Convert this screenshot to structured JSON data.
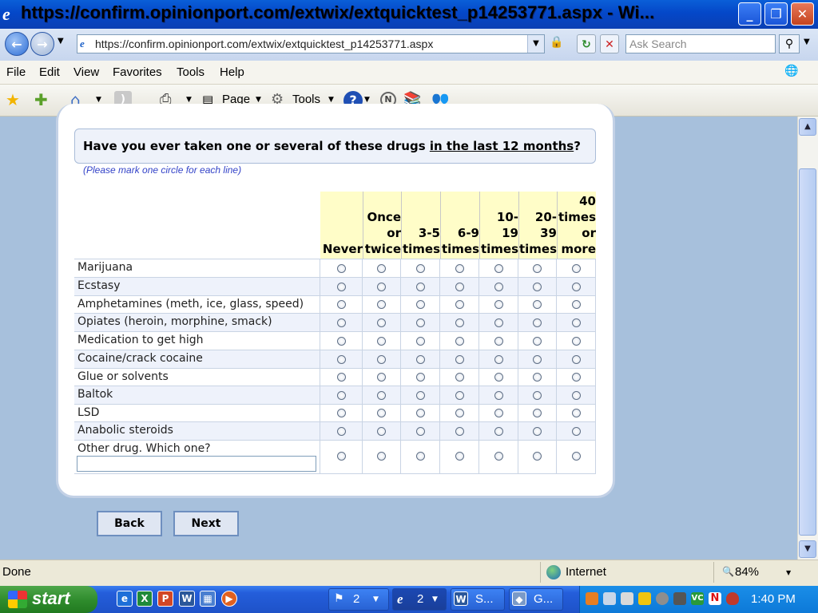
{
  "window": {
    "title": "https://confirm.opinionport.com/extwix/extquicktest_p14253771.aspx - Wi...",
    "minimize": "_",
    "maximize": "❐",
    "close": "✕"
  },
  "address": {
    "url": "https://confirm.opinionport.com/extwix/extquicktest_p14253771.aspx",
    "search_placeholder": "Ask Search"
  },
  "menu": [
    "File",
    "Edit",
    "View",
    "Favorites",
    "Tools",
    "Help"
  ],
  "command_bar": {
    "page": "Page",
    "tools": "Tools"
  },
  "survey": {
    "question_prefix": "Have you ever taken one or several of these drugs ",
    "question_emph": "in the last 12 months",
    "question_suffix": "?",
    "instruction": "(Please mark one circle for each line)",
    "columns": [
      [
        "Never"
      ],
      [
        "Once",
        "or",
        "twice"
      ],
      [
        "3-5",
        "times"
      ],
      [
        "6-9",
        "times"
      ],
      [
        "10-",
        "19",
        "times"
      ],
      [
        "20-",
        "39",
        "times"
      ],
      [
        "40",
        "times",
        "or",
        "more"
      ]
    ],
    "rows": [
      "Marijuana",
      "Ecstasy",
      "Amphetamines (meth, ice, glass, speed)",
      "Opiates (heroin, morphine, smack)",
      "Medication to get high",
      "Cocaine/crack cocaine",
      "Glue or solvents",
      "Baltok",
      "LSD",
      "Anabolic steroids",
      "Other drug. Which one?"
    ],
    "other_value": "",
    "back_label": "Back",
    "next_label": "Next"
  },
  "status": {
    "text": "Done",
    "zone": "Internet",
    "zoom": "84%"
  },
  "taskbar": {
    "start": "start",
    "tasks": [
      {
        "label": "2",
        "icon": "windows-group-icon"
      },
      {
        "label": "2",
        "icon": "ie-group-icon"
      },
      {
        "label": "S...",
        "icon": "word-icon"
      },
      {
        "label": "G...",
        "icon": "app-icon"
      }
    ],
    "clock": "1:40 PM"
  },
  "colors": {
    "title_bar": "#0a5fd8",
    "page_bg": "#a7c0dc",
    "header_yellow": "#fffdc8",
    "row_alt": "#eef2fb",
    "taskbar": "#245edb",
    "start_green": "#2e8b2c"
  }
}
